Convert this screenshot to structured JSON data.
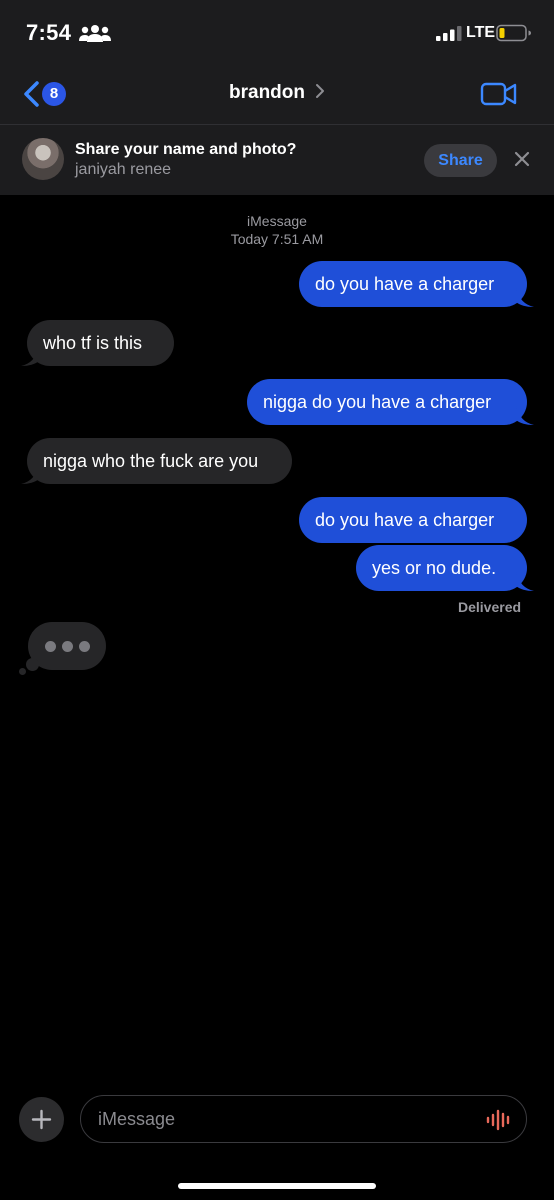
{
  "status_bar": {
    "time": "7:54",
    "network": "LTE"
  },
  "nav": {
    "unread_count": "8",
    "contact_name": "brandon"
  },
  "banner": {
    "title": "Share your name and photo?",
    "subtitle": "janiyah renee",
    "share_label": "Share"
  },
  "conversation": {
    "service": "iMessage",
    "timestamp": "Today 7:51 AM",
    "messages": [
      {
        "direction": "outgoing",
        "text": "do you have a charger"
      },
      {
        "direction": "incoming",
        "text": "who tf is this"
      },
      {
        "direction": "outgoing",
        "text": "nigga do you have a charger"
      },
      {
        "direction": "incoming",
        "text": "nigga who the fuck are you"
      },
      {
        "direction": "outgoing",
        "text": "do you have a charger"
      },
      {
        "direction": "outgoing",
        "text": "yes or no dude."
      }
    ],
    "delivery_status": "Delivered",
    "typing_indicator": true
  },
  "input": {
    "placeholder": "iMessage"
  },
  "colors": {
    "outgoing_bubble": "#1f4fd8",
    "incoming_bubble": "#262628",
    "accent": "#3c88ff",
    "audio_accent": "#e8695a"
  }
}
